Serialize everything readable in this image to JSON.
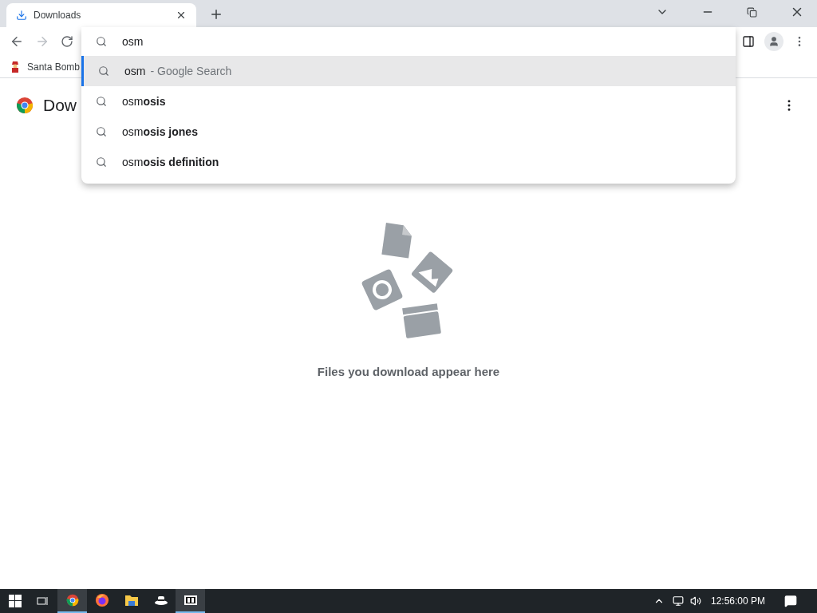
{
  "tabs": [
    {
      "title": "Downloads",
      "selected": true
    }
  ],
  "omnibox": {
    "value": "osm"
  },
  "suggestions": [
    {
      "text": "osm",
      "hint": "- Google Search",
      "selected": true
    },
    {
      "text": "osm**osis**",
      "selected": false
    },
    {
      "text": "osm**osis jones**",
      "selected": false
    },
    {
      "text": "osm**osis definition**",
      "selected": false
    }
  ],
  "bookmarks": [
    {
      "label": "Santa Bomb"
    }
  ],
  "page": {
    "title": "Dow",
    "empty_message": "Files you download appear here"
  },
  "taskbar": {
    "apps": [
      {
        "kind": "chrome",
        "active": true
      },
      {
        "kind": "firefox",
        "active": false
      },
      {
        "kind": "folder",
        "active": false
      },
      {
        "kind": "hat",
        "active": false
      },
      {
        "kind": "archive",
        "active": true
      }
    ],
    "clock": "12:56:00 PM"
  }
}
